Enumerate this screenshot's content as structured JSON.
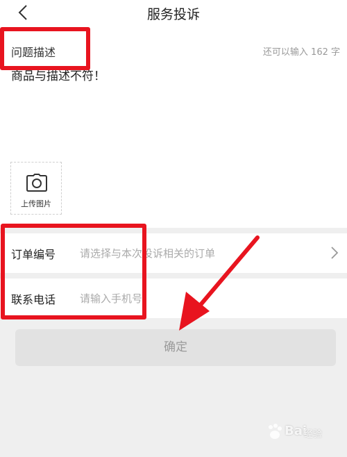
{
  "header": {
    "title": "服务投诉",
    "back_icon": "chevron-left-icon"
  },
  "description": {
    "label": "问题描述",
    "remaining": "还可以输入 162 字",
    "text": "商品与描述不符！",
    "upload_label": "上传图片",
    "upload_icon": "camera-icon"
  },
  "order": {
    "label": "订单编号",
    "placeholder": "请选择与本次投诉相关的订单",
    "chevron_icon": "chevron-right-icon"
  },
  "phone": {
    "label": "联系电话",
    "placeholder": "请输入手机号"
  },
  "actions": {
    "confirm_label": "确定"
  },
  "annotations": {
    "highlight_color": "#e8141f"
  },
  "watermark": {
    "brand": "Bai",
    "sub": "经验"
  }
}
